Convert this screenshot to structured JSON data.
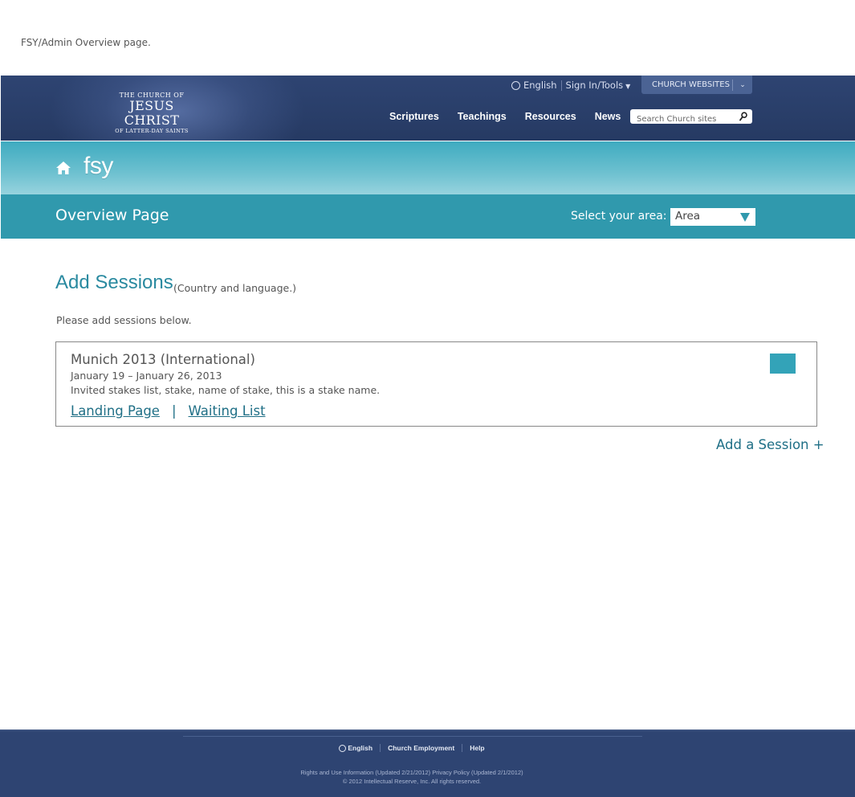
{
  "caption": "FSY/Admin Overview page.",
  "header": {
    "logo": {
      "line1": "THE CHURCH OF",
      "line2": "JESUS CHRIST",
      "line3": "OF LATTER-DAY SAINTS"
    },
    "language": "English",
    "sign_in": "Sign In/Tools",
    "church_websites": "CHURCH WEBSITES",
    "nav": [
      "Scriptures",
      "Teachings",
      "Resources",
      "News"
    ],
    "search_placeholder": "Search Church sites"
  },
  "fsy": {
    "logo_text": "fsy"
  },
  "overview": {
    "title": "Overview Page",
    "area_label": "Select your area:",
    "area_selected": "Area"
  },
  "content": {
    "title": "Add Sessions",
    "subtitle": "(Country and language.)",
    "intro": "Please add sessions below.",
    "session": {
      "name": "Munich 2013 (International)",
      "dates": "January 19 – January 26, 2013",
      "stakes": "Invited stakes list, stake, name of stake, this is a stake name.",
      "landing_link": "Landing Page",
      "separator": "|",
      "waiting_link": "Waiting List"
    },
    "add_session": "Add a Session +"
  },
  "footer": {
    "language": "English",
    "employment": "Church Employment",
    "help": "Help",
    "legal_line1": "Rights and Use Information (Updated 2/21/2012)  Privacy Policy (Updated 2/1/2012)",
    "legal_line2": "© 2012 Intellectual Reserve, Inc. All rights reserved."
  },
  "colors": {
    "header_navy": "#2e4472",
    "teal_band": "#3099ad",
    "teal_light": "#6ec1d0",
    "link_teal": "#1f6f86",
    "swatch": "#33a3b8"
  }
}
